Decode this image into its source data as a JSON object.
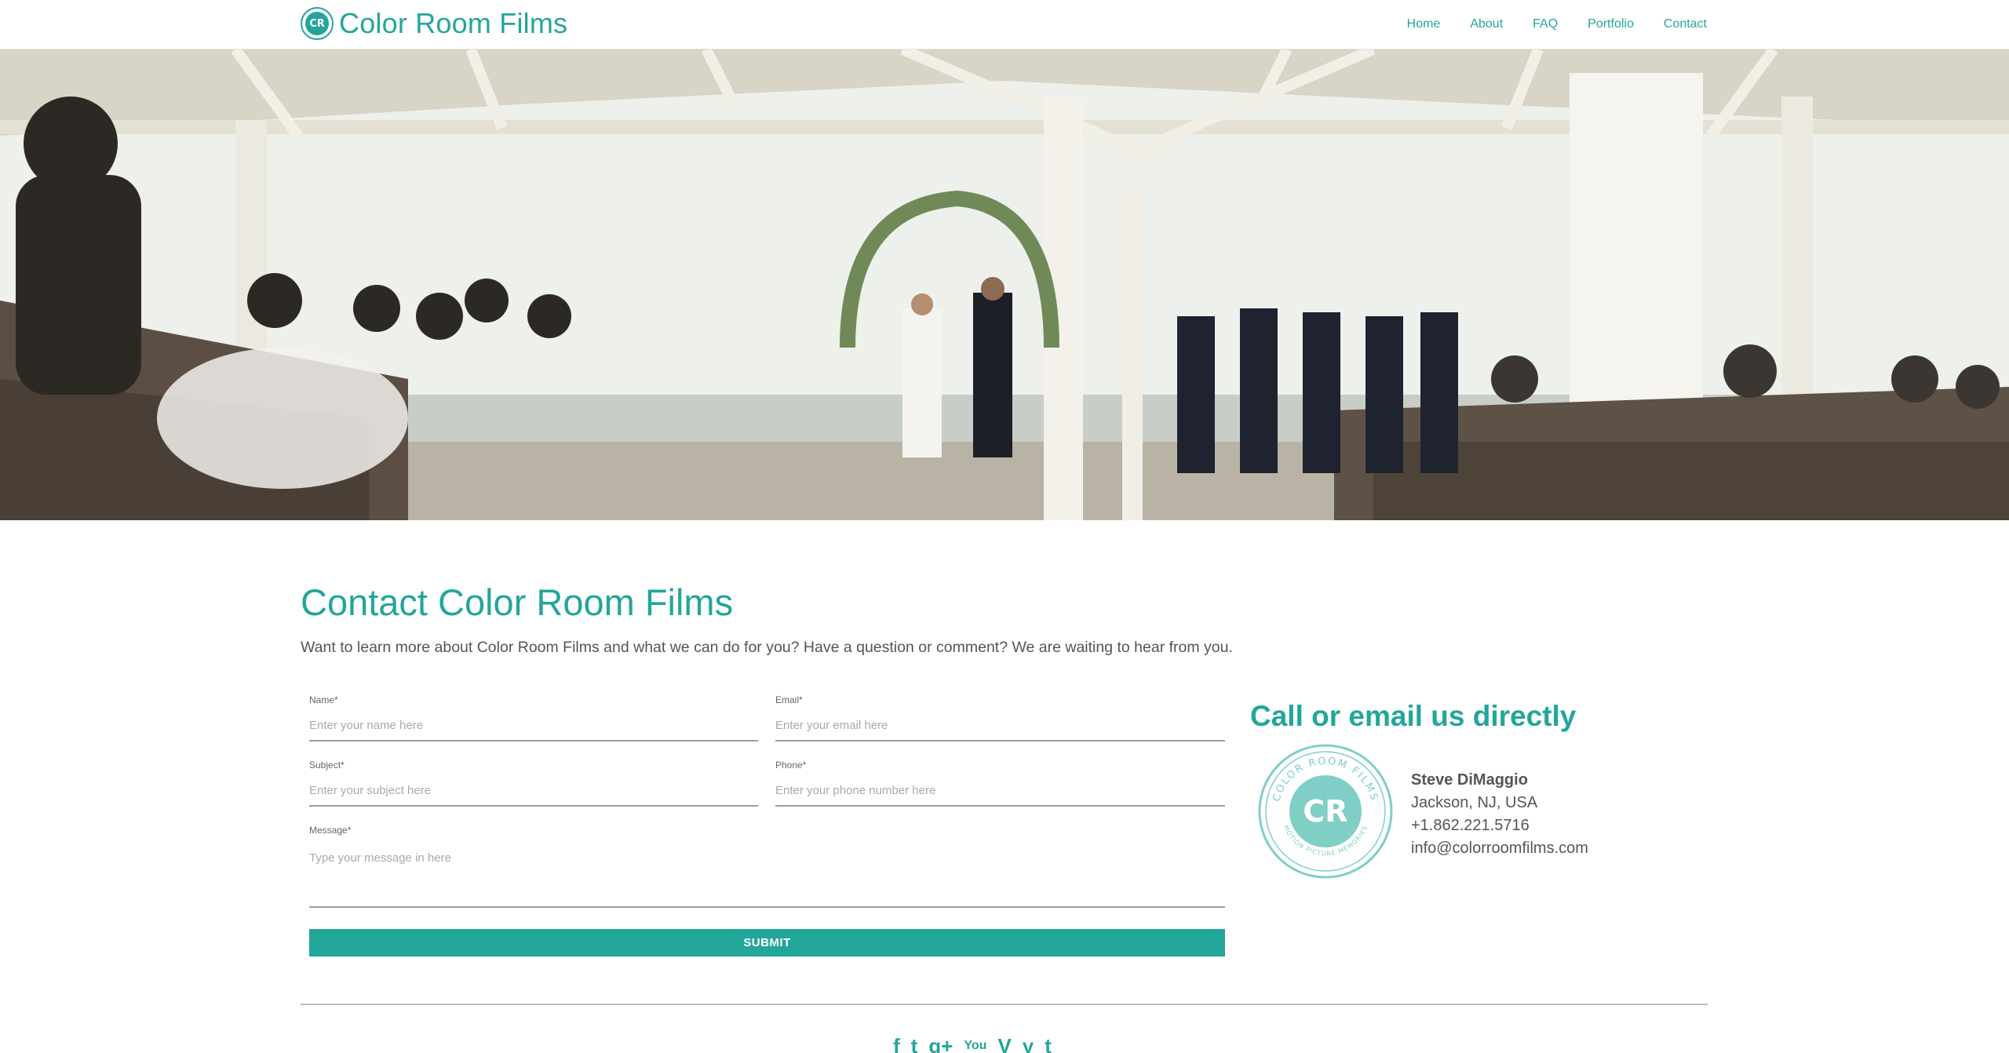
{
  "header": {
    "brand": "Color Room Films",
    "logo_monogram": "CR",
    "nav": [
      "Home",
      "About",
      "FAQ",
      "Portfolio",
      "Contact"
    ]
  },
  "hero": {
    "subject": "wedding-ceremony-under-gazebo"
  },
  "contact": {
    "title": "Contact Color Room Films",
    "intro": "Want to learn more about Color Room Films and what we can do for you? Have a question or comment? We are waiting to hear from you.",
    "form": {
      "name_label": "Name*",
      "name_placeholder": "Enter your name here",
      "email_label": "Email*",
      "email_placeholder": "Enter your email here",
      "subject_label": "Subject*",
      "subject_placeholder": "Enter your subject here",
      "phone_label": "Phone*",
      "phone_placeholder": "Enter your phone number here",
      "message_label": "Message*",
      "message_placeholder": "Type your message in here",
      "submit_label": "SUBMIT"
    }
  },
  "direct": {
    "title": "Call or email us directly",
    "seal_top_text": "COLOR ROOM FILMS",
    "seal_bottom_text": "MOTION PICTURE MEMORIES",
    "seal_monogram": "CR",
    "name": "Steve DiMaggio",
    "location": "Jackson, NJ, USA",
    "phone": "+1.862.221.5716",
    "email": "info@colorroomfilms.com"
  },
  "footer": {
    "social": [
      {
        "icon": "facebook-icon",
        "glyph": "f"
      },
      {
        "icon": "twitter-icon",
        "glyph": "t"
      },
      {
        "icon": "google-plus-icon",
        "glyph": "g+"
      },
      {
        "icon": "youtube-icon",
        "glyph": "You"
      },
      {
        "icon": "vimeo-icon",
        "glyph": "V"
      },
      {
        "icon": "yelp-icon",
        "glyph": "y"
      },
      {
        "icon": "tumblr-icon",
        "glyph": "t"
      }
    ]
  },
  "colors": {
    "accent": "#23a69a",
    "text": "#555555",
    "rule": "#bdbdbd"
  }
}
